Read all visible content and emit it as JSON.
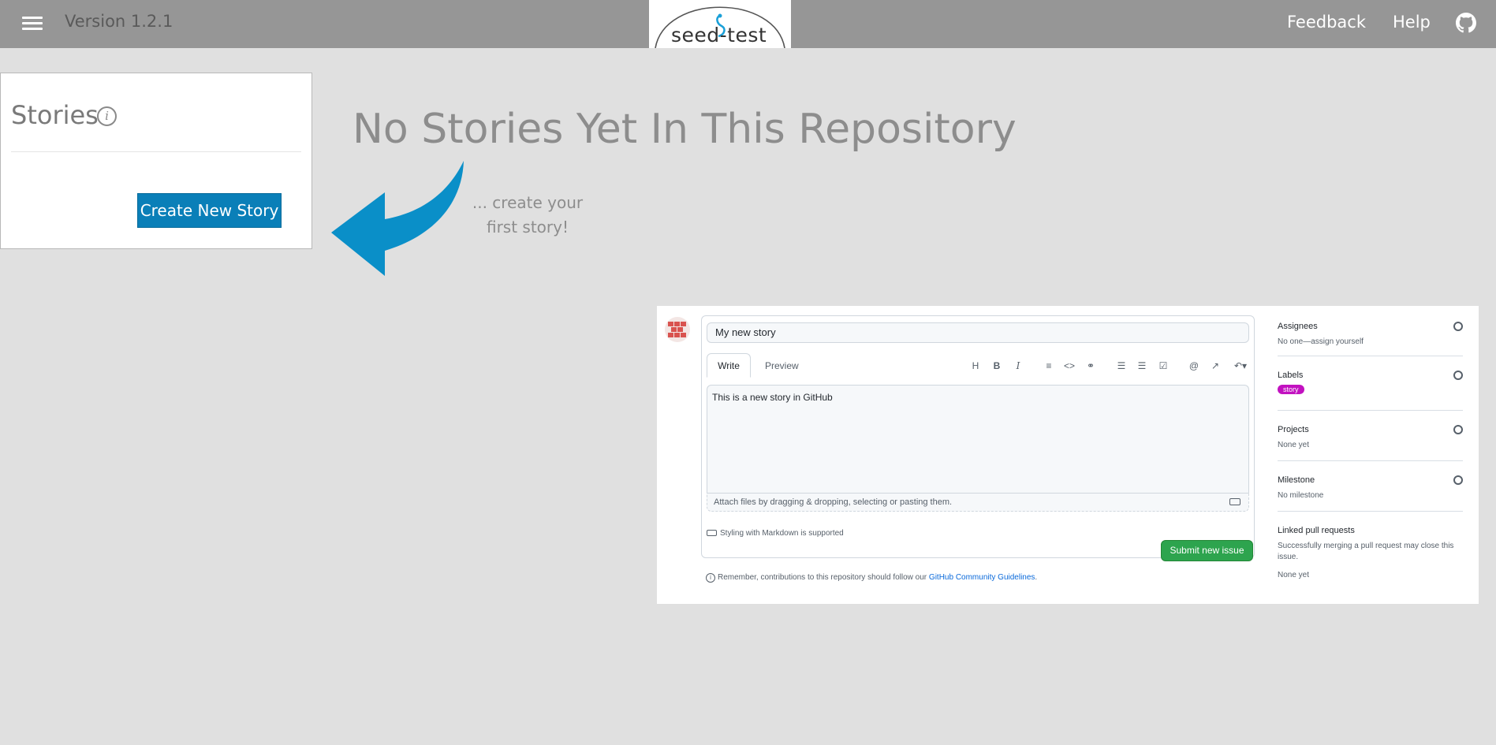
{
  "header": {
    "version": "Version 1.2.1",
    "logo_text": "seed-test",
    "feedback": "Feedback",
    "help": "Help"
  },
  "stories": {
    "title": "Stories",
    "info": "i",
    "create_button": "Create New Story"
  },
  "empty_state": {
    "heading": "No Stories Yet In This Repository",
    "hint_line1": "... create your",
    "hint_line2": "first story!"
  },
  "github_preview": {
    "title_value": "My new story",
    "tabs": {
      "write": "Write",
      "preview": "Preview"
    },
    "toolbar": [
      "H",
      "B",
      "I",
      "quote",
      "code",
      "link",
      "bullet-list",
      "numbered-list",
      "task-list",
      "@",
      "reference",
      "undo"
    ],
    "body": "This is a new story in GitHub",
    "attach_hint": "Attach files by dragging & dropping, selecting or pasting them.",
    "markdown_note": "Styling with Markdown is supported",
    "submit": "Submit new issue",
    "guidelines_prefix": "Remember, contributions to this repository should follow our",
    "guidelines_link": "GitHub Community Guidelines",
    "guidelines_suffix": ".",
    "sidebar": {
      "assignees_title": "Assignees",
      "assignees_value": "No one—assign yourself",
      "labels_title": "Labels",
      "label_pill": "story",
      "projects_title": "Projects",
      "projects_value": "None yet",
      "milestone_title": "Milestone",
      "milestone_value": "No milestone",
      "linked_title": "Linked pull requests",
      "linked_desc": "Successfully merging a pull request may close this issue.",
      "linked_value": "None yet"
    }
  },
  "colors": {
    "topbar": "#969696",
    "background": "#e0e0e0",
    "primary_button": "#0a7fb8",
    "arrow": "#0a8fc8",
    "submit_green": "#2da44e",
    "label_story": "#c211c0"
  }
}
